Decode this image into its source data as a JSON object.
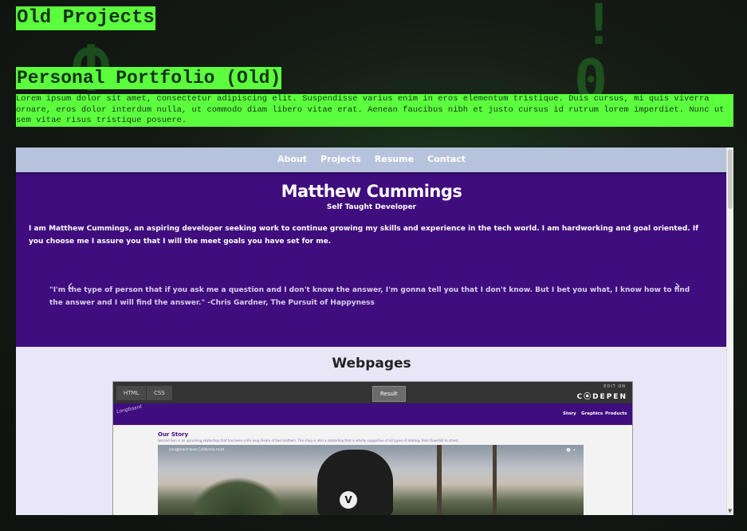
{
  "page": {
    "heading": "Old Projects",
    "project_title": "Personal Portfolio (Old)",
    "project_description": "Lorem ipsum dolor sit amet, consectetur adipiscing elit. Suspendisse varius enim in eros elementum tristique. Duis cursus, mi quis viverra ornare, eros dolor interdum nulla, ut commodo diam libero vitae erat. Aenean faucibus nibh et justo cursus id rutrum lorem imperdiet. Nunc ut sem vitae risus tristique posuere."
  },
  "portfolio": {
    "nav": [
      "About",
      "Projects",
      "Resume",
      "Contact"
    ],
    "name": "Matthew Cummings",
    "subtitle": "Self Taught Developer",
    "bio": "I am Matthew Cummings, an aspiring developer seeking work to continue growing my skills and experience in the tech world. I am hardworking and goal oriented. If you choose me I assure you that I will the meet goals you have set for me.",
    "quote": "\"I'm the type of person that if you ask me a question and I don't know the answer, I'm gonna tell you that I don't know. But I bet you what, I know how to find the answer and I will find the answer.\" -Chris Gardner, The Pursuit of Happyness",
    "arrow_left": "‹",
    "arrow_right": "›",
    "section_heading": "Webpages"
  },
  "codepen": {
    "tabs": [
      "HTML",
      "CSS"
    ],
    "result_tab": "Result",
    "edit_on": "EDIT ON",
    "brand": "C⦿DEPEN",
    "logo": "Longboard",
    "links": [
      "Story",
      "Graphics",
      "Products"
    ],
    "story_heading": "Our Story",
    "story_text": "Second Sun is an upcoming skateshop that has been a life long dream of two brothers. The shop is also a skateshop that is wholly supportive of all types of skating, from Downhill to street.",
    "video_title": "Longboard love California mad",
    "video_controls": "🕓 ↗"
  },
  "colors": {
    "highlight": "#5cff3d",
    "hero_bg": "#3f0d7d",
    "nav_bg": "#b7c3dc"
  }
}
